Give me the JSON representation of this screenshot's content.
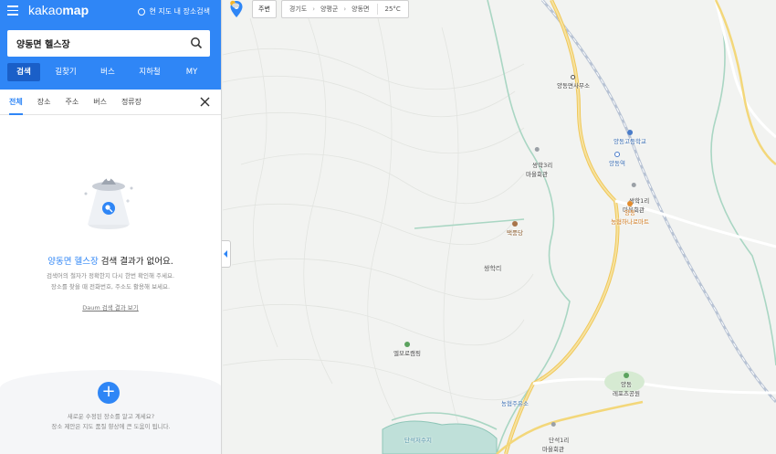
{
  "header": {
    "brand_prefix": "kakao",
    "brand_suffix": "map",
    "map_search_toggle": "현 지도 내 장소검색"
  },
  "search": {
    "value": "양동면 헬스장"
  },
  "main_tabs": [
    "검색",
    "길찾기",
    "버스",
    "지하철",
    "MY"
  ],
  "sub_tabs": [
    "전체",
    "장소",
    "주소",
    "버스",
    "정류장"
  ],
  "empty_state": {
    "keyword": "양동면 헬스장",
    "title_rest": " 검색 결과가 없어요.",
    "desc_line1": "검색어의 철자가 정확한지 다시 한번 확인해 주세요.",
    "desc_line2": "장소를 찾을 때 전화번호, 주소도 활용해 보세요.",
    "daum_link": "Daum 검색 결과 보기"
  },
  "bottom": {
    "add_symbol": "+",
    "line1": "새로운 수정된 장소를 알고 계세요?",
    "line2": "장소 제안은 지도 품질 향상에 큰 도움이 됩니다."
  },
  "map_toolbar": {
    "nearby_label": "주변",
    "breadcrumbs": [
      "경기도",
      "양평군",
      "양동면"
    ],
    "temperature": "25°C"
  },
  "map_labels": {
    "office": "양동면사무소",
    "school": "양동고등학교",
    "station": "양동역",
    "ssanghak3ri": "쌍학3리\n마을회관",
    "ssanghak1ri": "쌍학1리\n마을회관",
    "mart_line1": "양동",
    "mart_line2": "농협하나로마트",
    "taekpungdang": "택풍당",
    "ssanghakri": "쌍학리",
    "camping": "엘모로캠핑",
    "gas": "농협주유소",
    "danseok1ri": "단석1리\n마을회관",
    "sports_line1": "양동",
    "sports_line2": "레포츠공원",
    "reservoir": "단석저수지"
  },
  "colors": {
    "brand_blue": "#2f86f6",
    "active_tab": "#1a5fc8",
    "road_yellow": "#f6d86b",
    "river_green": "#a9d6c3"
  }
}
